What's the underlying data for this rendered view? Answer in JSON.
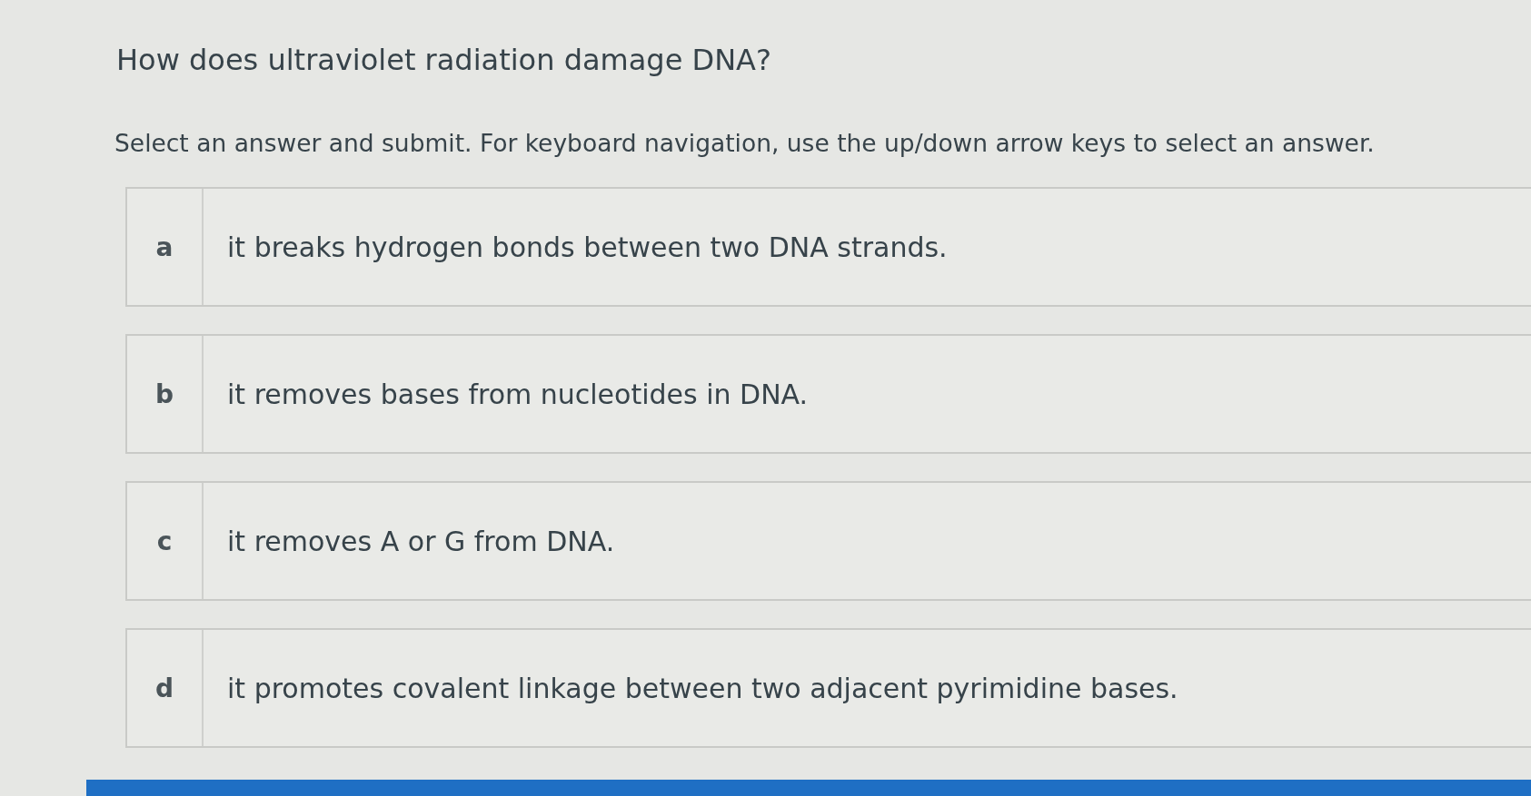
{
  "question": {
    "title": "How does ultraviolet radiation damage DNA?",
    "instructions": "Select an answer and submit. For keyboard navigation, use the up/down arrow keys to select an answer."
  },
  "options": [
    {
      "letter": "a",
      "text": "it breaks hydrogen bonds between two DNA strands.",
      "selected": false
    },
    {
      "letter": "b",
      "text": "it removes bases from nucleotides in DNA.",
      "selected": false
    },
    {
      "letter": "c",
      "text": "it removes A or G from DNA.",
      "selected": false
    },
    {
      "letter": "d",
      "text": "it promotes covalent linkage between two adjacent pyrimidine bases.",
      "selected": false
    }
  ]
}
